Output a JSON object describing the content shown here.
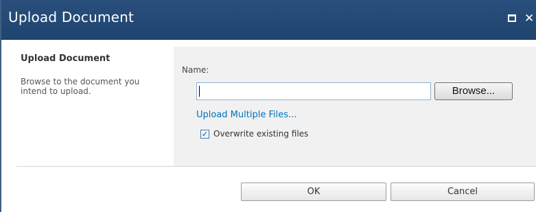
{
  "window": {
    "title": "Upload Document",
    "maximize_icon": "maximize-icon",
    "close_icon": "close-icon",
    "close_glyph": "✕"
  },
  "section": {
    "title": "Upload Document",
    "description": "Browse to the document you intend to upload."
  },
  "form": {
    "name_label": "Name:",
    "file_value": "",
    "browse_label": "Browse...",
    "upload_multiple_link": "Upload Multiple Files...",
    "overwrite_checked": true,
    "overwrite_label": "Overwrite existing files",
    "check_glyph": "✓"
  },
  "buttons": {
    "ok_label": "OK",
    "cancel_label": "Cancel"
  },
  "colors": {
    "titlebar": "#1f4470",
    "link": "#0072bc",
    "panel": "#f1f1f1"
  }
}
